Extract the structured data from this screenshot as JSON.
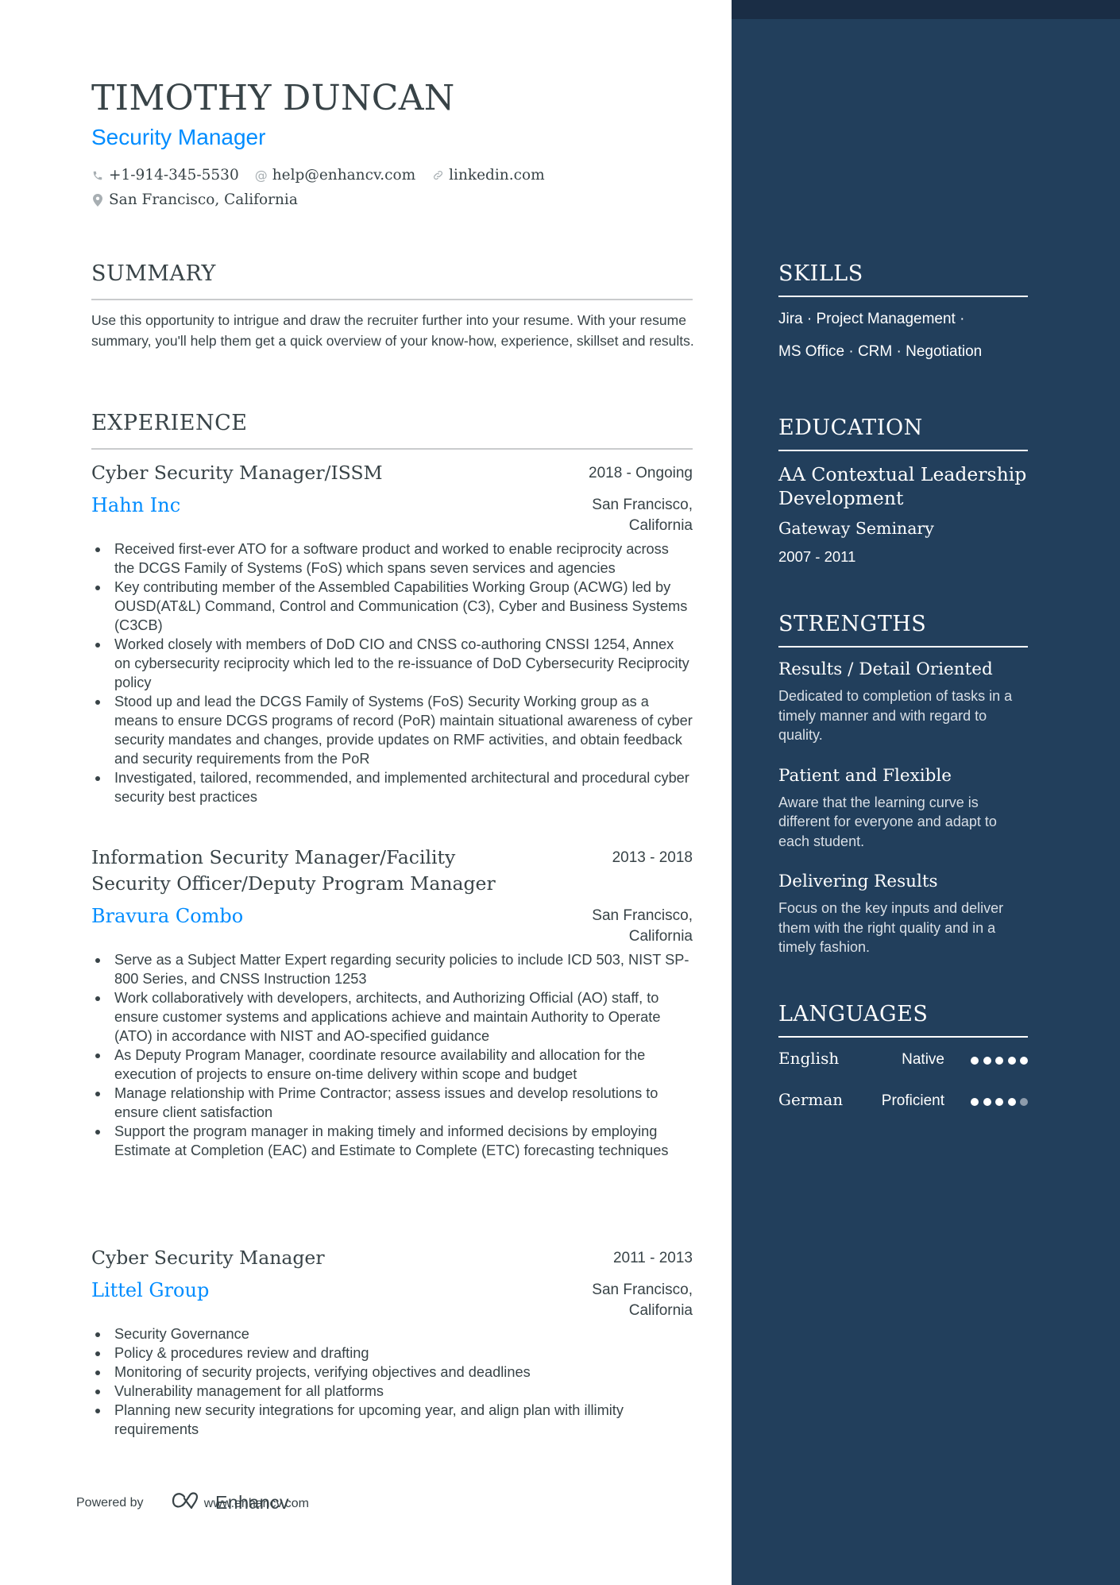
{
  "header": {
    "name": "TIMOTHY DUNCAN",
    "role": "Security Manager",
    "contacts": [
      {
        "icon": "phone-icon",
        "text": "+1-914-345-5530"
      },
      {
        "icon": "at-icon",
        "text": "help@enhancv.com"
      },
      {
        "icon": "link-icon",
        "text": "linkedin.com"
      }
    ],
    "location": {
      "icon": "location-pin-icon",
      "text": "San Francisco, California"
    }
  },
  "summary": {
    "title": "SUMMARY",
    "text": "Use this opportunity to intrigue and draw the recruiter further into your resume. With your resume summary, you'll help them get a quick overview of your know-how, experience, skillset and results."
  },
  "experience": {
    "title": "EXPERIENCE",
    "jobs": [
      {
        "title": "Cyber Security Manager/ISSM",
        "dates": "2018 - Ongoing",
        "company": "Hahn Inc",
        "location_line1": "San Francisco,",
        "location_line2": "California",
        "bullets": [
          "Received first-ever ATO for a software product and worked to enable reciprocity across the DCGS Family of Systems (FoS) which spans seven services and agencies",
          "Key contributing member of the Assembled Capabilities Working Group (ACWG) led by OUSD(AT&L) Command, Control and Communication (C3), Cyber and Business Systems (C3CB)",
          "Worked closely with members of DoD CIO and CNSS co-authoring CNSSI 1254, Annex on cybersecurity reciprocity which led to the re-issuance of DoD Cybersecurity Reciprocity policy",
          "Stood up and lead the DCGS Family of Systems (FoS) Security Working group as a means to ensure DCGS programs of record (PoR) maintain situational awareness of cyber security mandates and changes, provide updates on RMF activities, and obtain feedback and security requirements from the PoR",
          "Investigated, tailored, recommended, and implemented architectural and procedural cyber security best practices"
        ]
      },
      {
        "title": "Information Security Manager/Facility Security Officer/Deputy Program Manager",
        "dates": "2013 - 2018",
        "company": "Bravura Combo",
        "location_line1": "San Francisco,",
        "location_line2": "California",
        "bullets": [
          "Serve as a Subject Matter Expert regarding security policies to include ICD 503, NIST SP-800 Series, and CNSS Instruction 1253",
          "Work collaboratively with developers, architects, and Authorizing Official (AO) staff, to ensure customer systems and applications achieve and maintain Authority to Operate (ATO) in accordance with NIST and AO-specified guidance",
          "As Deputy Program Manager, coordinate resource availability and allocation for the execution of projects to ensure on-time delivery within scope and budget",
          "Manage relationship with Prime Contractor; assess issues and develop resolutions to ensure client satisfaction",
          "Support the program manager in making timely and informed decisions by employing Estimate at Completion (EAC) and Estimate to Complete (ETC) forecasting techniques"
        ]
      },
      {
        "title": "Cyber Security Manager",
        "dates": "2011 - 2013",
        "company": "Littel Group",
        "location_line1": "San Francisco,",
        "location_line2": "California",
        "bullets": [
          "Security Governance",
          "Policy & procedures review and drafting",
          "Monitoring of security projects, verifying objectives and deadlines",
          "Vulnerability management for all platforms",
          "Planning new security integrations for upcoming year, and align plan with illimity requirements"
        ]
      }
    ]
  },
  "sidebar": {
    "skills": {
      "title": "SKILLS",
      "lines": [
        "Jira · Project Management ·",
        "MS Office · CRM · Negotiation"
      ]
    },
    "education": {
      "title": "EDUCATION",
      "degree": "AA Contextual Leadership Development",
      "school": "Gateway Seminary",
      "dates": "2007 - 2011"
    },
    "strengths": {
      "title": "STRENGTHS",
      "items": [
        {
          "title": "Results / Detail Oriented",
          "desc": "Dedicated to completion of tasks in a timely manner and with regard to quality."
        },
        {
          "title": "Patient and Flexible",
          "desc": "Aware that the learning curve is different for everyone and adapt to each student."
        },
        {
          "title": "Delivering Results",
          "desc": "Focus on the key inputs and deliver them with the right quality and in a timely fashion."
        }
      ]
    },
    "languages": {
      "title": "LANGUAGES",
      "items": [
        {
          "name": "English",
          "level": "Native",
          "rating": 5,
          "max": 5
        },
        {
          "name": "German",
          "level": "Proficient",
          "rating": 4,
          "max": 5
        }
      ]
    }
  },
  "footer": {
    "powered_by": "Powered by",
    "brand": "Enhancv",
    "url": "www.enhancv.com"
  },
  "colors": {
    "accent": "#008cff",
    "sidebar_bg": "#223f5c",
    "sidebar_band": "#1a2d45",
    "text": "#384347"
  }
}
